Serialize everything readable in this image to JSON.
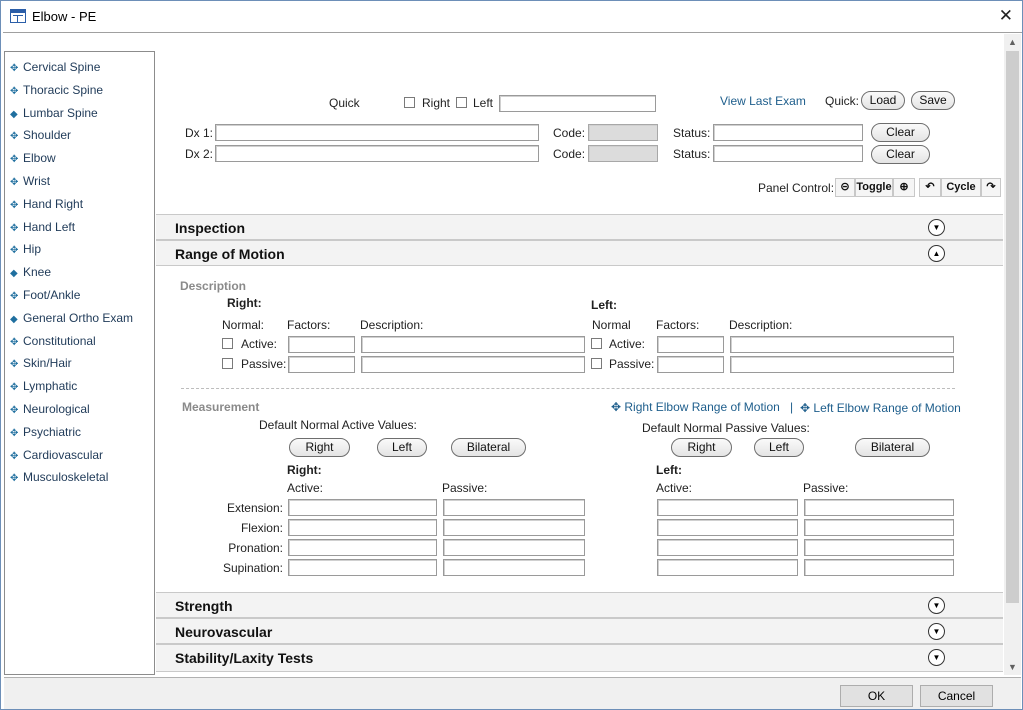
{
  "window": {
    "title": "Elbow - PE",
    "close_glyph": "✕"
  },
  "sidebar": {
    "items": [
      {
        "label": "Cervical Spine",
        "icon": "✥"
      },
      {
        "label": "Thoracic Spine",
        "icon": "✥"
      },
      {
        "label": "Lumbar Spine",
        "icon": "◆"
      },
      {
        "label": "Shoulder",
        "icon": "✥"
      },
      {
        "label": "Elbow",
        "icon": "✥"
      },
      {
        "label": "Wrist",
        "icon": "✥"
      },
      {
        "label": "Hand Right",
        "icon": "✥"
      },
      {
        "label": "Hand Left",
        "icon": "✥"
      },
      {
        "label": "Hip",
        "icon": "✥"
      },
      {
        "label": "Knee",
        "icon": "◆"
      },
      {
        "label": "Foot/Ankle",
        "icon": "✥"
      },
      {
        "label": "General Ortho Exam",
        "icon": "◆"
      },
      {
        "label": "Constitutional",
        "icon": "✥"
      },
      {
        "label": "Skin/Hair",
        "icon": "✥"
      },
      {
        "label": "Lymphatic",
        "icon": "✥"
      },
      {
        "label": "Neurological",
        "icon": "✥"
      },
      {
        "label": "Psychiatric",
        "icon": "✥"
      },
      {
        "label": "Cardiovascular",
        "icon": "✥"
      },
      {
        "label": "Musculoskeletal",
        "icon": "✥"
      }
    ]
  },
  "header": {
    "quick_label": "Quick",
    "right_label": "Right",
    "left_label": "Left",
    "quick_value": "",
    "view_last_exam": "View Last Exam",
    "quick2_label": "Quick:",
    "load_label": "Load",
    "save_label": "Save",
    "dx1_label": "Dx 1:",
    "dx2_label": "Dx 2:",
    "dx1_value": "",
    "dx2_value": "",
    "code_label": "Code:",
    "status_label": "Status:",
    "clear_label": "Clear",
    "panel_control_label": "Panel Control:",
    "toggle_label": "Toggle",
    "cycle_label": "Cycle"
  },
  "panels": {
    "inspection": "Inspection",
    "range_of_motion": "Range of Motion",
    "strength": "Strength",
    "neurovascular": "Neurovascular",
    "stability": "Stability/Laxity Tests"
  },
  "rom": {
    "description_title": "Description",
    "right": "Right:",
    "left": "Left:",
    "normal_colon": "Normal:",
    "normal": "Normal",
    "factors": "Factors:",
    "description": "Description:",
    "active": "Active:",
    "passive": "Passive:",
    "measurement_title": "Measurement",
    "right_link": "Right Elbow Range of Motion",
    "link_sep": "|",
    "left_link": "Left Elbow Range of Motion",
    "default_active": "Default Normal Active Values:",
    "default_passive": "Default Normal Passive Values:",
    "btn_right": "Right",
    "btn_left": "Left",
    "btn_bilateral": "Bilateral",
    "active_col": "Active:",
    "passive_col": "Passive:",
    "rows": [
      "Extension:",
      "Flexion:",
      "Pronation:",
      "Supination:"
    ]
  },
  "footer": {
    "ok": "OK",
    "cancel": "Cancel"
  }
}
